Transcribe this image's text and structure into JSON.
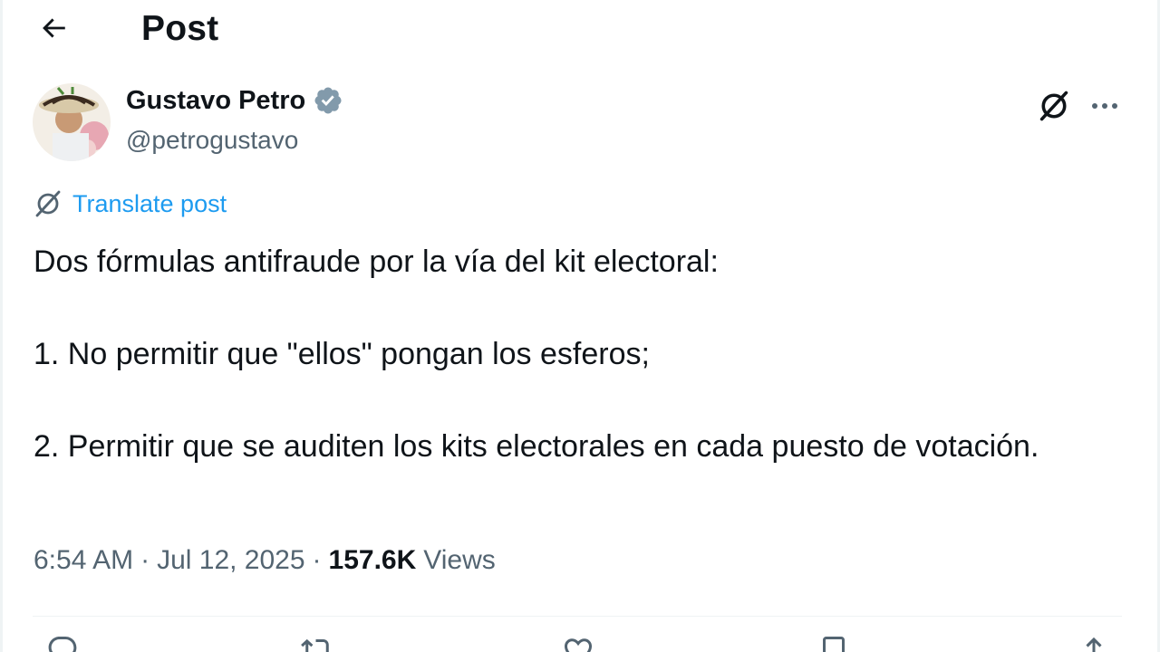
{
  "header": {
    "title": "Post",
    "back_icon": "arrow-left-icon"
  },
  "author": {
    "name": "Gustavo Petro",
    "handle": "@petrogustavo",
    "verified": true,
    "verified_color": "#829aab"
  },
  "translate": {
    "label": "Translate post",
    "color": "#1d9bf0"
  },
  "post": {
    "paragraphs": [
      "Dos fórmulas antifraude por la vía del kit electoral:",
      "1. No permitir que \"ellos\" pongan los esferos;",
      "2. Permitir que se auditen los kits electorales en cada puesto de votación."
    ]
  },
  "meta": {
    "time": "6:54 AM",
    "separator": "·",
    "date": "Jul 12, 2025",
    "views_count": "157.6K",
    "views_label": "Views"
  },
  "actions": [
    "reply-icon",
    "repost-icon",
    "like-icon",
    "bookmark-icon",
    "share-icon"
  ],
  "colors": {
    "text": "#0f1419",
    "secondary": "#536471",
    "accent": "#1d9bf0",
    "divider": "#eff3f4"
  }
}
